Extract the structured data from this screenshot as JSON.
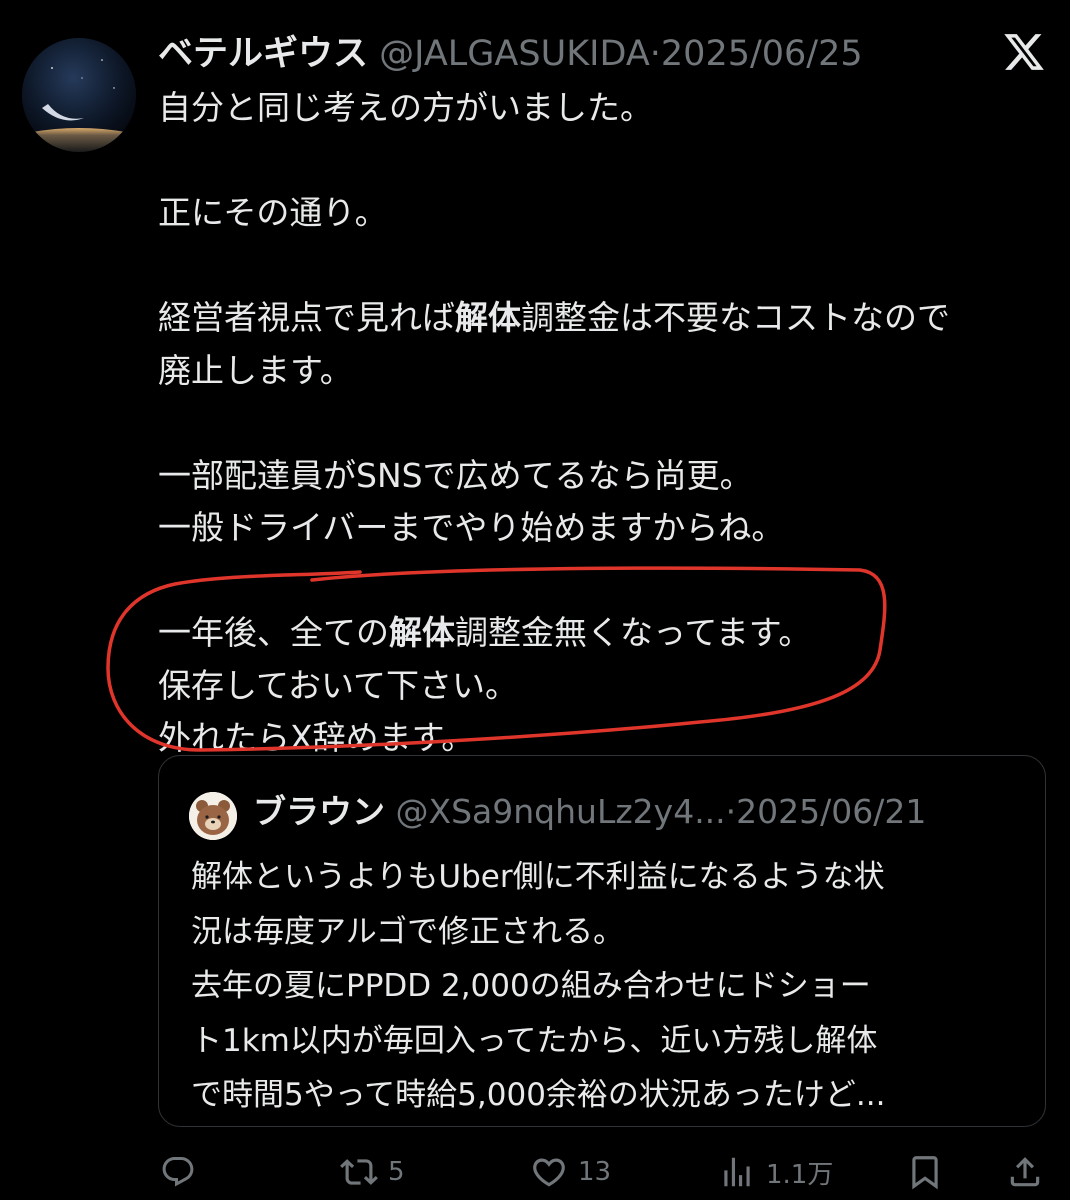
{
  "tweet": {
    "display_name": "ベテルギウス",
    "handle": "@JALGASUKIDA",
    "separator": "·",
    "date": "2025/06/25",
    "lines": [
      [
        "自分と同じ考えの方がいました。"
      ],
      [],
      [
        "正にその通り。"
      ],
      [],
      [
        "経営者視点で見れば",
        "解体",
        "調整金は不要なコストなので"
      ],
      [
        "廃止します。"
      ],
      [],
      [
        "一部配達員がSNSで広めてるなら尚更。"
      ],
      [
        "一般ドライバーまでやり始めますからね。"
      ],
      [],
      [
        "一年後、全ての",
        "解体",
        "調整金無くなってます。"
      ],
      [
        "保存しておいて下さい。"
      ],
      [
        "外れたらX辞めます。"
      ]
    ]
  },
  "quoted_tweet": {
    "display_name": "ブラウン",
    "handle": "@XSa9nqhuLz2y4...",
    "separator": "·",
    "date": "2025/06/21",
    "lines": [
      "解体というよりもUber側に不利益になるような状",
      "況は毎度アルゴで修正される。",
      "去年の夏にPPDD 2,000の組み合わせにドショー",
      "ト1km以内が毎回入ってたから、近い方残し解体",
      "で時間5やって時給5,000余裕の状況あったけど..."
    ]
  },
  "actions": {
    "reply_icon": "reply-icon",
    "retweet_icon": "retweet-icon",
    "retweet_count": "5",
    "like_icon": "heart-icon",
    "like_count": "13",
    "views_icon": "views-icon",
    "views_count": "1.1万",
    "bookmark_icon": "bookmark-icon",
    "share_icon": "share-icon"
  },
  "colors": {
    "background": "#000000",
    "text": "#e7e9ea",
    "secondary": "#71767b",
    "border": "#2f3336",
    "annotation": "#e0352b"
  }
}
